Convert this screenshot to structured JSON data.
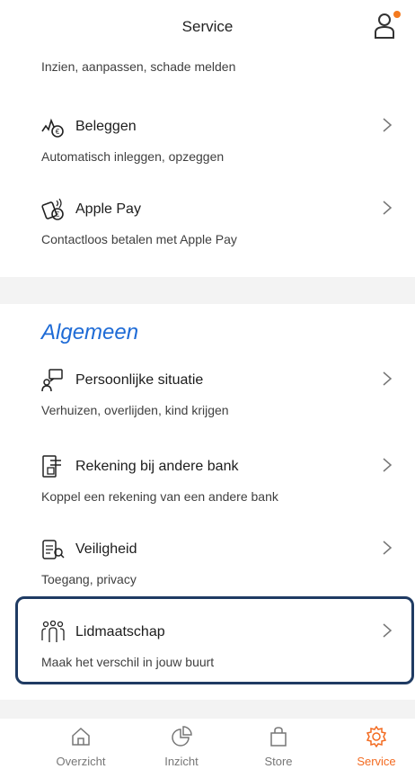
{
  "header": {
    "title": "Service"
  },
  "top_item": {
    "subtitle": "Inzien, aanpassen, schade melden"
  },
  "items": [
    {
      "title": "Beleggen",
      "subtitle": "Automatisch inleggen, opzeggen"
    },
    {
      "title": "Apple Pay",
      "subtitle": "Contactloos betalen met Apple Pay"
    },
    {
      "title": "Persoonlijke situatie",
      "subtitle": "Verhuizen, overlijden, kind krijgen"
    },
    {
      "title": "Rekening bij andere bank",
      "subtitle": "Koppel een rekening van een andere bank"
    },
    {
      "title": "Veiligheid",
      "subtitle": "Toegang, privacy"
    },
    {
      "title": "Lidmaatschap",
      "subtitle": "Maak het verschil in jouw buurt"
    }
  ],
  "section": {
    "title": "Algemeen"
  },
  "tabs": [
    {
      "label": "Overzicht",
      "icon": "home-icon"
    },
    {
      "label": "Inzicht",
      "icon": "pie-chart-icon"
    },
    {
      "label": "Store",
      "icon": "shopping-bag-icon"
    },
    {
      "label": "Service",
      "icon": "gear-icon",
      "active": true
    }
  ],
  "colors": {
    "accent": "#f36b21",
    "section_title": "#1e6bd6",
    "highlight_border": "#1f3b63"
  }
}
